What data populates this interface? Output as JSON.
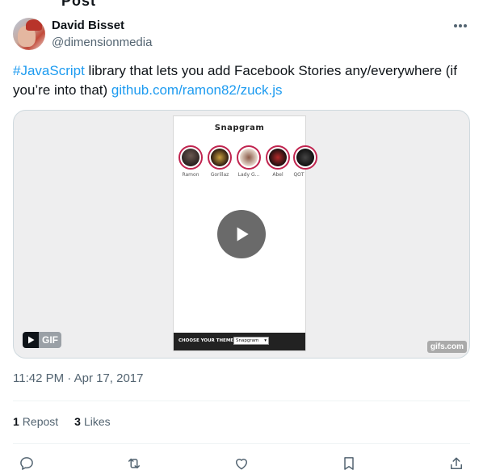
{
  "page": {
    "top_cut_text": "Post"
  },
  "author": {
    "name": "David Bisset",
    "handle": "@dimensionmedia"
  },
  "tweet": {
    "hashtag": "#JavaScript",
    "text": " library that lets you add Facebook Stories any/everywhere (if you’re into that) ",
    "link": "github.com/ramon82/zuck.js"
  },
  "media": {
    "app_title": "Snapgram",
    "stories": [
      {
        "label": "Ramon"
      },
      {
        "label": "Gorillaz"
      },
      {
        "label": "Lady G..."
      },
      {
        "label": "Abel"
      },
      {
        "label": "QOT"
      }
    ],
    "theme_label": "CHOOSE YOUR THEME:",
    "theme_value": "Snapgram",
    "gif_badge": "GIF",
    "watermark": "gifs.com"
  },
  "timestamp": "11:42 PM · Apr 17, 2017",
  "stats": {
    "reposts_count": "1",
    "reposts_label": "Repost",
    "likes_count": "3",
    "likes_label": "Likes"
  },
  "actions": {
    "reply_icon": "reply-icon",
    "repost_icon": "repost-icon",
    "like_icon": "heart-icon",
    "bookmark_icon": "bookmark-icon",
    "share_icon": "share-icon"
  },
  "colors": {
    "accent": "#1d9bf0",
    "text": "#0f1419",
    "secondary": "#536471",
    "story_ring": "#c0244f"
  }
}
